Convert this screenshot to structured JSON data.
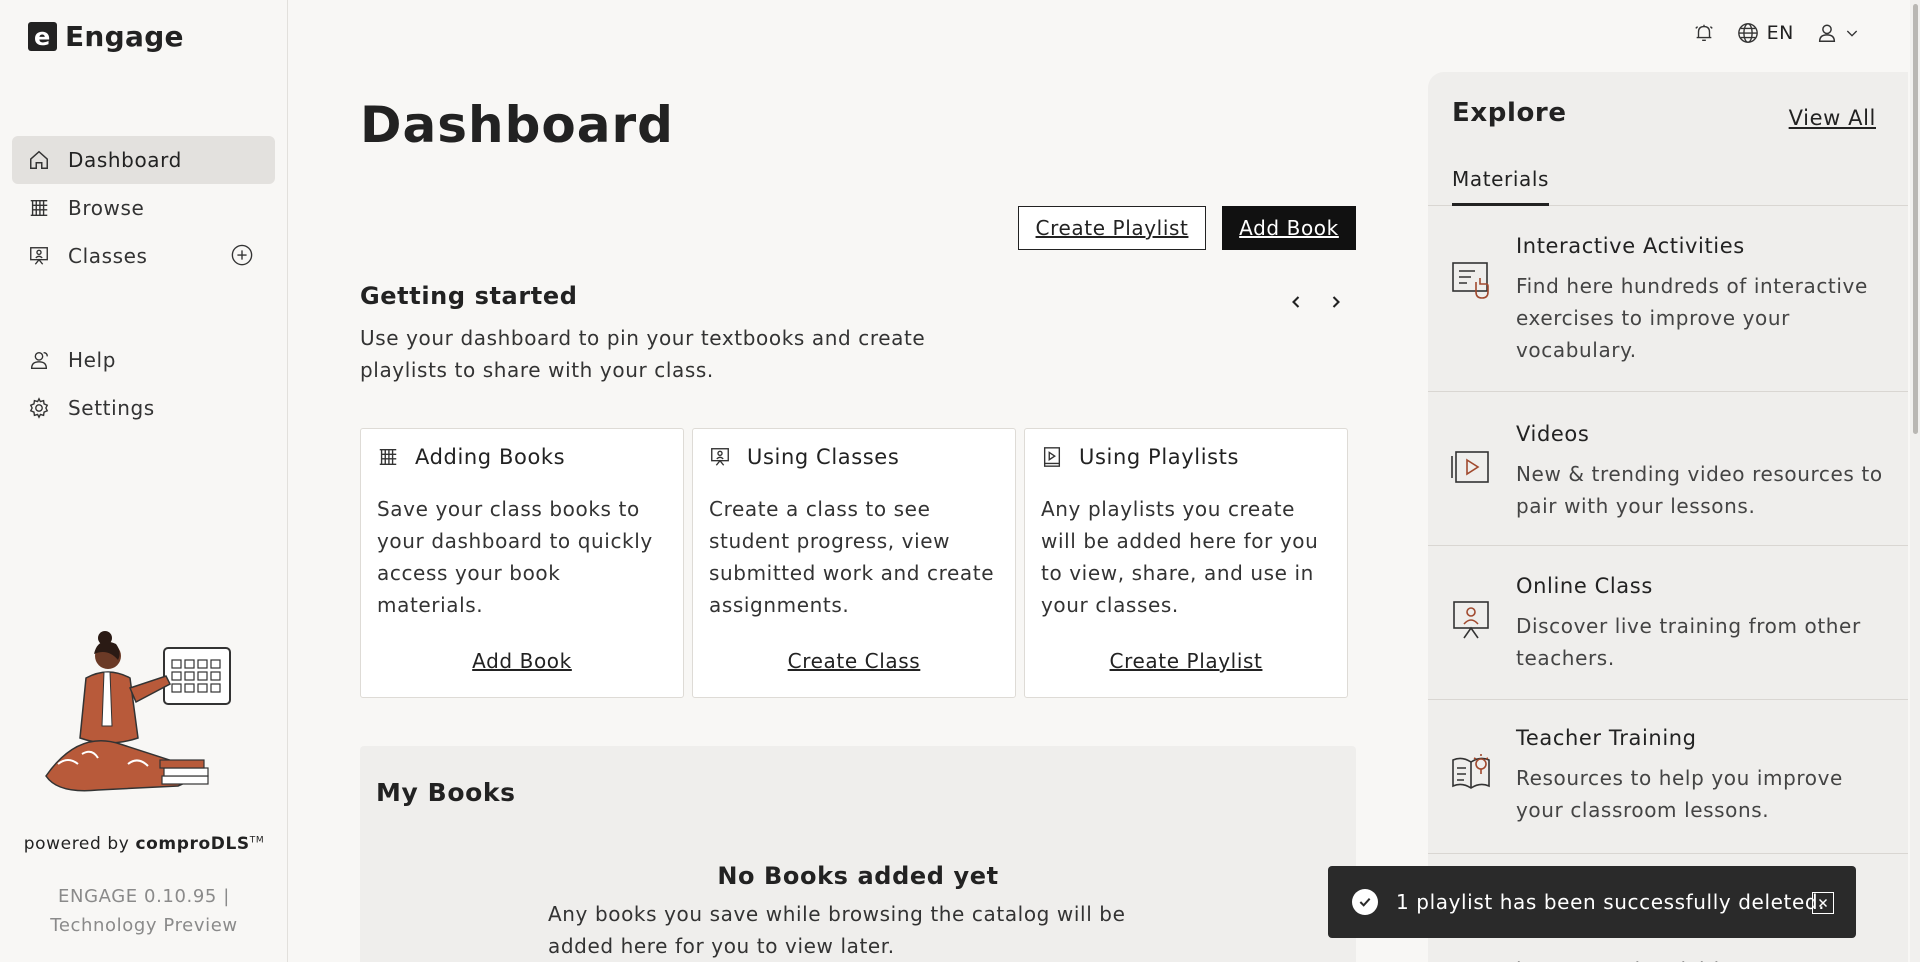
{
  "app": {
    "logo_letter": "e",
    "name": "Engage"
  },
  "sidebar": {
    "items": [
      {
        "label": "Dashboard",
        "icon": "home-icon",
        "active": true
      },
      {
        "label": "Browse",
        "icon": "books-icon"
      },
      {
        "label": "Classes",
        "icon": "classroom-icon"
      },
      {
        "label": "Help",
        "icon": "help-icon"
      },
      {
        "label": "Settings",
        "icon": "gear-icon"
      }
    ],
    "powered_prefix": "powered by ",
    "powered_brand": "comproDLS",
    "powered_tm": "TM",
    "version_line1": "ENGAGE 0.10.95 |",
    "version_line2": "Technology Preview"
  },
  "header": {
    "language": "EN"
  },
  "main": {
    "title": "Dashboard",
    "create_playlist_label": "Create Playlist",
    "add_book_label": "Add Book",
    "getting_started": {
      "title": "Getting started",
      "description": "Use your dashboard to pin your textbooks and create playlists to share with your class.",
      "cards": [
        {
          "title": "Adding Books",
          "body": "Save your class books to your dashboard to quickly access your book materials.",
          "link": "Add Book"
        },
        {
          "title": "Using Classes",
          "body": "Create a class to see student progress, view submitted work and create assignments.",
          "link": "Create Class"
        },
        {
          "title": "Using Playlists",
          "body": "Any playlists you create will be added here for you to view, share, and use in your classes.",
          "link": "Create Playlist"
        }
      ]
    },
    "my_books": {
      "title": "My Books",
      "empty_title": "No Books added yet",
      "empty_description": "Any books you save while browsing the catalog will be added here for you to view later."
    }
  },
  "explore": {
    "title": "Explore",
    "view_all": "View All",
    "tab": "Materials",
    "items": [
      {
        "title": "Interactive Activities",
        "description": "Find here hundreds of interactive exercises to improve your vocabulary.",
        "icon": "interactive-icon"
      },
      {
        "title": "Videos",
        "description": "New & trending video resources to pair with your lessons.",
        "icon": "video-icon"
      },
      {
        "title": "Online Class",
        "description": "Discover live training from other teachers.",
        "icon": "online-class-icon"
      },
      {
        "title": "Teacher Training",
        "description": "Resources to help you improve your classroom lessons.",
        "icon": "teacher-training-icon"
      },
      {
        "title": "",
        "description": "lessons and activities.",
        "icon": "more-icon"
      }
    ]
  },
  "toast": {
    "message": "1 playlist has been successfully deleted."
  },
  "colors": {
    "accent_icon": "#a0492e",
    "text": "#222222",
    "background": "#f8f7f5",
    "panel": "#efeeec"
  }
}
